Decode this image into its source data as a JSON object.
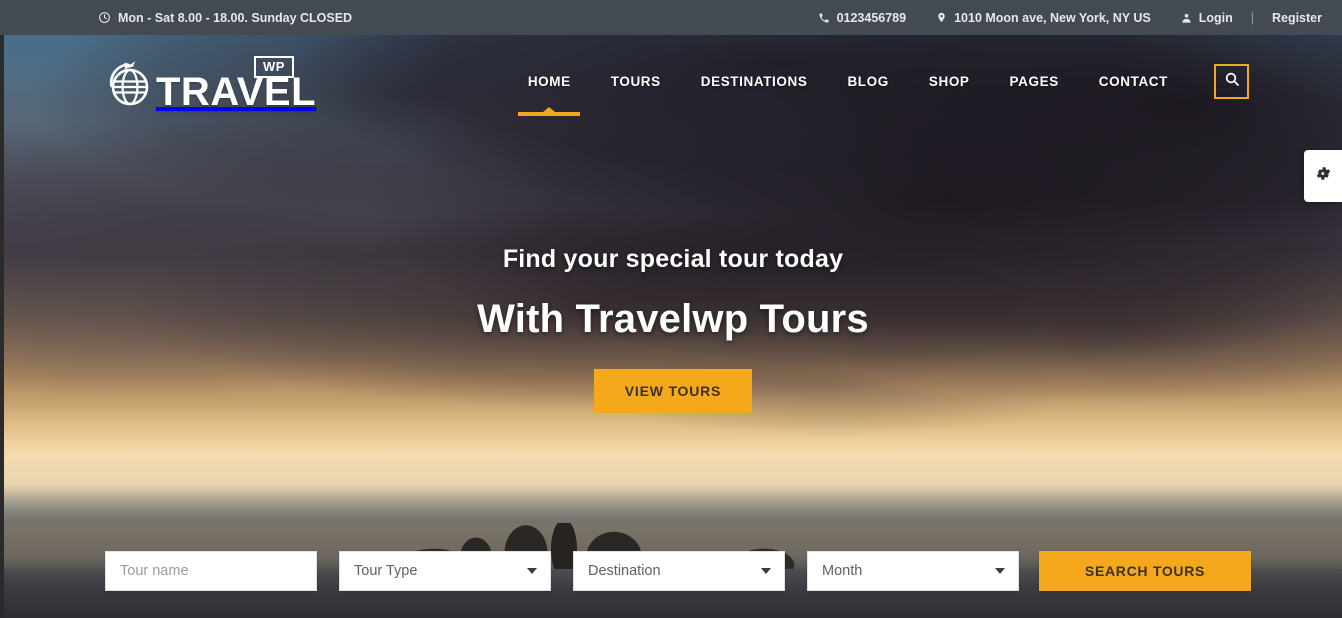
{
  "topbar": {
    "hours": "Mon - Sat 8.00 - 18.00. Sunday CLOSED",
    "phone": "0123456789",
    "address": "1010 Moon ave, New York, NY US",
    "login": "Login",
    "separator": "|",
    "register": "Register"
  },
  "logo": {
    "word": "TRAVEL",
    "badge": "WP"
  },
  "nav": {
    "items": [
      {
        "label": "HOME",
        "active": true
      },
      {
        "label": "TOURS",
        "active": false
      },
      {
        "label": "DESTINATIONS",
        "active": false
      },
      {
        "label": "BLOG",
        "active": false
      },
      {
        "label": "SHOP",
        "active": false
      },
      {
        "label": "PAGES",
        "active": false
      },
      {
        "label": "CONTACT",
        "active": false
      }
    ]
  },
  "hero": {
    "subtitle": "Find your special tour today",
    "title": "With Travelwp Tours",
    "cta": "VIEW TOURS"
  },
  "search_form": {
    "tour_name_placeholder": "Tour name",
    "tour_name_value": "",
    "tour_type_value": "Tour Type",
    "destination_value": "Destination",
    "month_value": "Month",
    "submit_label": "SEARCH TOURS"
  },
  "colors": {
    "accent": "#f5a81c",
    "topbar_bg": "#434a52",
    "nav_text": "#ffffff",
    "field_text": "#616161"
  }
}
